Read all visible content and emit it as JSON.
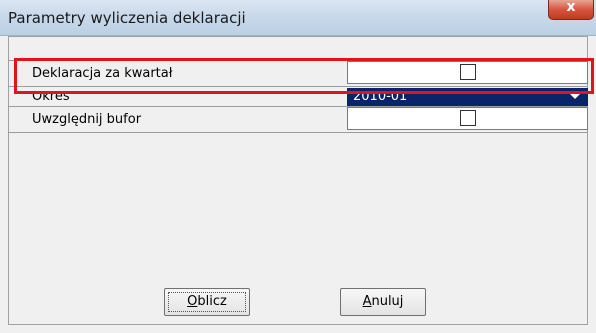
{
  "window": {
    "title": "Parametry wyliczenia deklaracji",
    "close_label": "x"
  },
  "fields": {
    "quarter": {
      "label": "Deklaracja za kwartał",
      "checked": false
    },
    "period": {
      "label": "Okres",
      "value": "2010-01"
    },
    "buffer": {
      "label": "Uwzględnij bufor",
      "checked": false
    }
  },
  "buttons": {
    "calculate_mnemonic": "O",
    "calculate_rest": "blicz",
    "cancel_mnemonic": "A",
    "cancel_rest": "nuluj"
  },
  "colors": {
    "selection": "#0a246a",
    "highlight_box": "#e0151b"
  }
}
